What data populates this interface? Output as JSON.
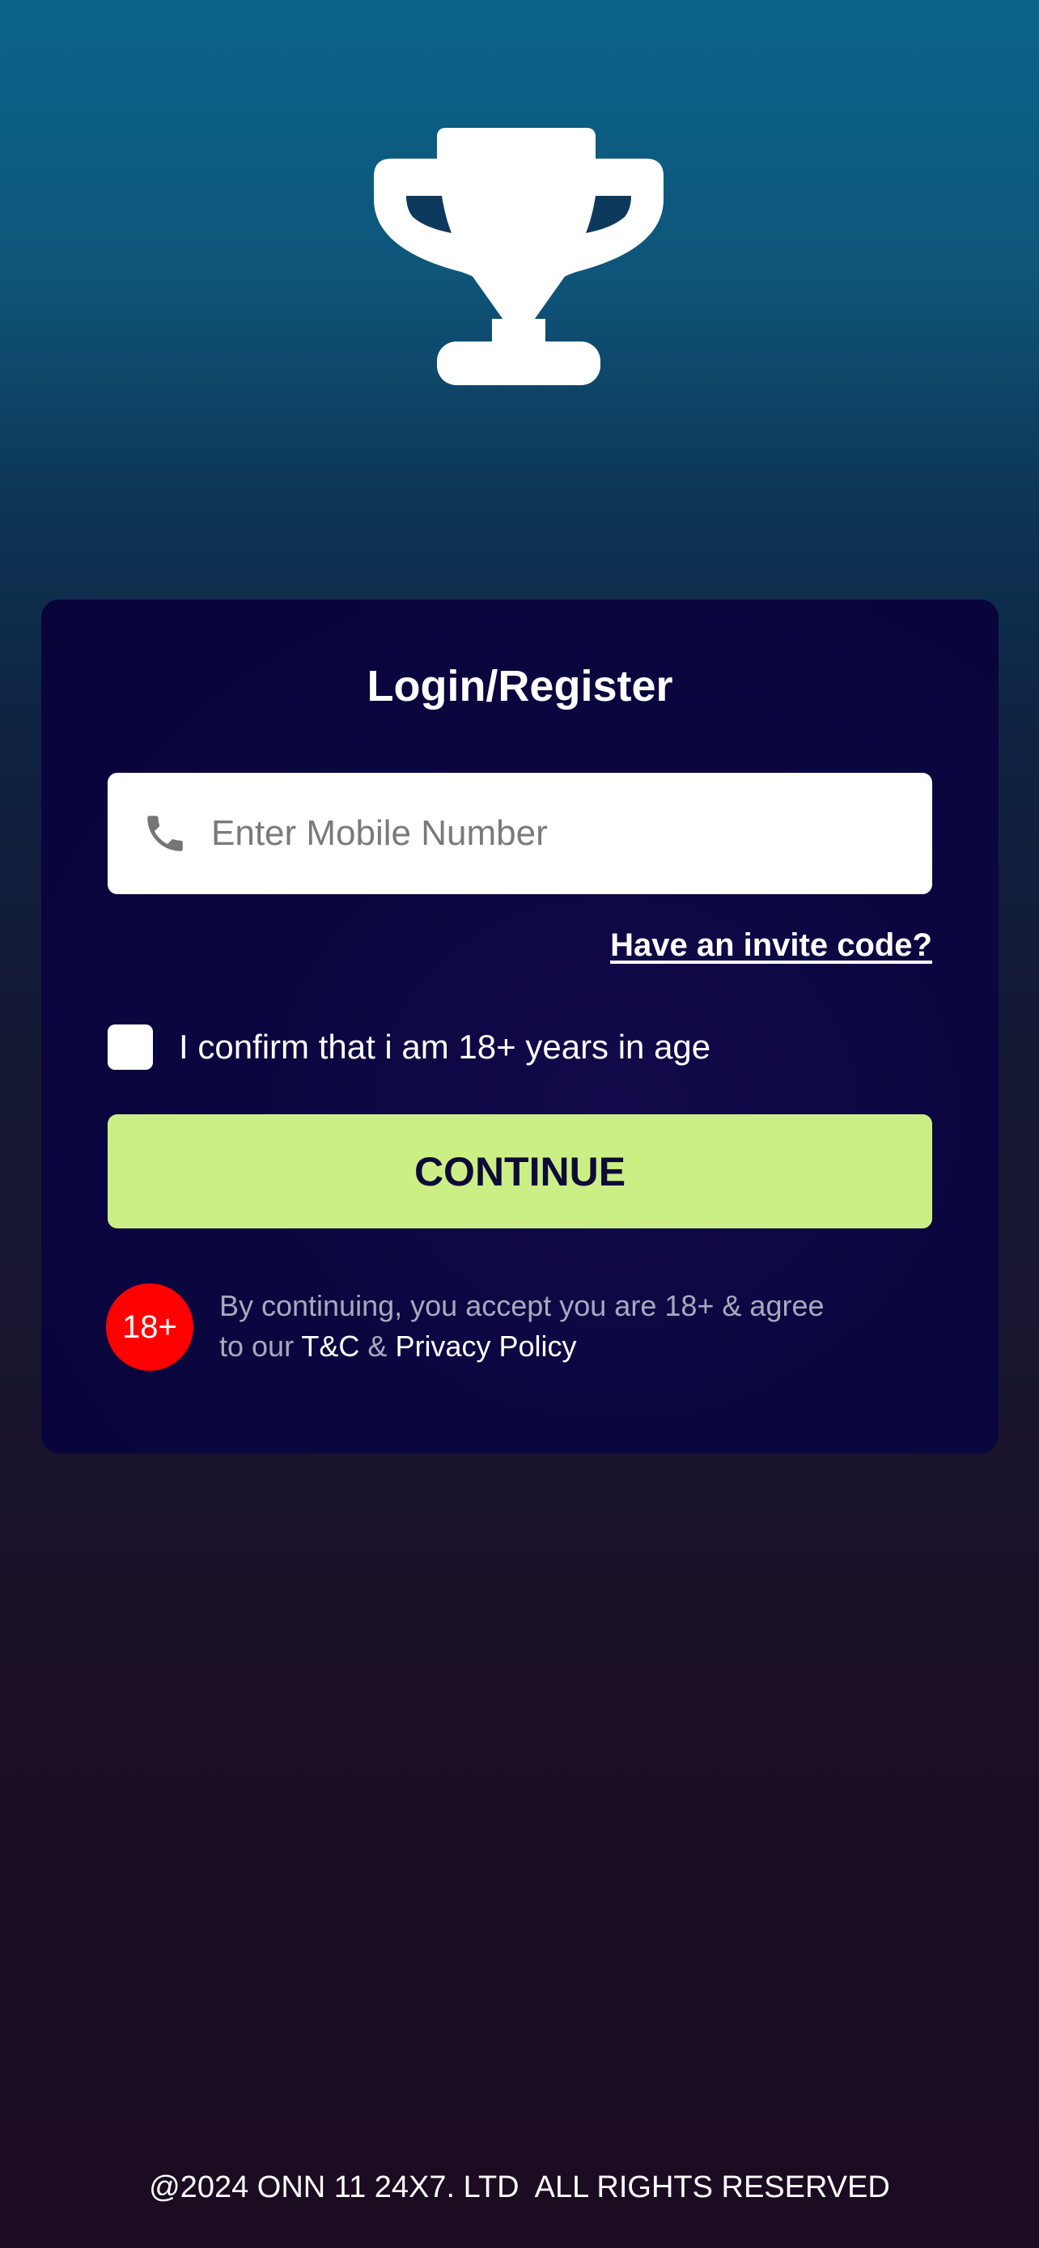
{
  "header": {
    "logo_icon": "trophy-icon"
  },
  "login_card": {
    "title": "Login/Register",
    "phone_field": {
      "icon": "phone-icon",
      "placeholder": "Enter Mobile Number",
      "value": ""
    },
    "invite_link": "Have an invite code?",
    "age_confirm": {
      "label": "I confirm that i am 18+ years in age",
      "checked": false
    },
    "continue_label": "CONTINUE",
    "age_badge": "18+",
    "disclaimer": {
      "line1": "By continuing, you accept you are 18+ & agree",
      "line2_prefix": "to our ",
      "terms_link": "T&C",
      "separator": " & ",
      "privacy_link": "Privacy Policy"
    }
  },
  "footer": {
    "copyright": "@2024 ONN 11 24X7. LTD  ALL RIGHTS RESERVED"
  },
  "colors": {
    "accent_button": "#ccef85",
    "age_badge": "#ff0000",
    "card_background": "#0b0640"
  }
}
